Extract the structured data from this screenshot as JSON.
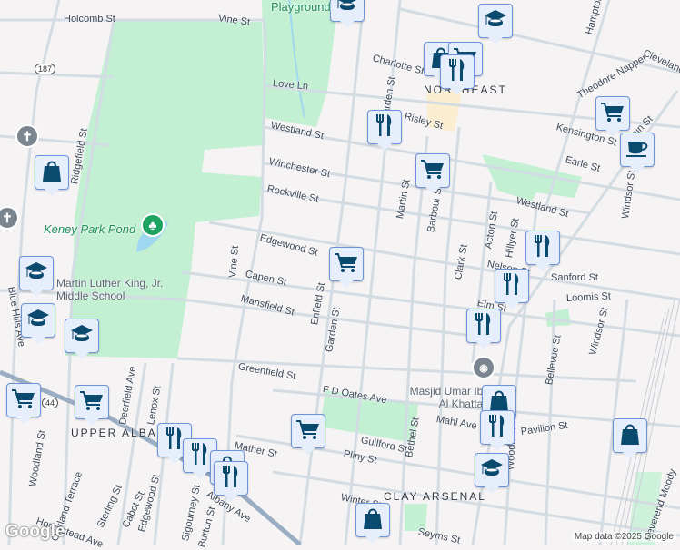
{
  "map": {
    "streets": [
      {
        "id": "holcomb-st",
        "label": "Holcomb St"
      },
      {
        "id": "vine-st-top",
        "label": "Vine St"
      },
      {
        "id": "love-ln",
        "label": "Love Ln"
      },
      {
        "id": "westland-st",
        "label": "Westland St"
      },
      {
        "id": "winchester-st",
        "label": "Winchester St"
      },
      {
        "id": "rockville-st",
        "label": "Rockville St"
      },
      {
        "id": "edgewood-st",
        "label": "Edgewood St"
      },
      {
        "id": "capen-st",
        "label": "Capen St"
      },
      {
        "id": "mansfield-st",
        "label": "Mansfield St"
      },
      {
        "id": "greenfield-st",
        "label": "Greenfield St"
      },
      {
        "id": "fd-oates-ave",
        "label": "F D Oates Ave"
      },
      {
        "id": "mahl-ave",
        "label": "Mahl Ave"
      },
      {
        "id": "pavilion-st",
        "label": "Pavilion St"
      },
      {
        "id": "guilford-st",
        "label": "Guilford St"
      },
      {
        "id": "pliny-st",
        "label": "Pliny St"
      },
      {
        "id": "mather-st",
        "label": "Mather St"
      },
      {
        "id": "winter-st",
        "label": "Winter St"
      },
      {
        "id": "seyms-st",
        "label": "Seyms St"
      },
      {
        "id": "charlotte-st",
        "label": "Charlotte St"
      },
      {
        "id": "risley-st",
        "label": "Risley St"
      },
      {
        "id": "kensington-st",
        "label": "Kensington St"
      },
      {
        "id": "earle-st",
        "label": "Earle St"
      },
      {
        "id": "westland-st-east",
        "label": "Westland St"
      },
      {
        "id": "nelson-st",
        "label": "Nelson St"
      },
      {
        "id": "sanford-st",
        "label": "Sanford St"
      },
      {
        "id": "loomis-st",
        "label": "Loomis St"
      },
      {
        "id": "elm-st",
        "label": "Elm St"
      },
      {
        "id": "cleveland-ave",
        "label": "Cleveland"
      },
      {
        "id": "theodore-napper",
        "label": "Theodore Napper"
      },
      {
        "id": "main-st",
        "label": "Main St"
      },
      {
        "id": "windsor-st",
        "label": "Windsor St"
      },
      {
        "id": "windsor-st-south",
        "label": "Windsor St"
      },
      {
        "id": "hampton",
        "label": "Hampton"
      },
      {
        "id": "martin-st",
        "label": "Martin St"
      },
      {
        "id": "barbour-st",
        "label": "Barbour St"
      },
      {
        "id": "clark-st",
        "label": "Clark St"
      },
      {
        "id": "acton-st",
        "label": "Acton St"
      },
      {
        "id": "hillyer-st",
        "label": "Hillyer St"
      },
      {
        "id": "garden-st-north",
        "label": "Garden St"
      },
      {
        "id": "garden-st",
        "label": "Garden St"
      },
      {
        "id": "enfield-st",
        "label": "Enfield St"
      },
      {
        "id": "vine-st",
        "label": "Vine St"
      },
      {
        "id": "ridgefield-st",
        "label": "Ridgefield St"
      },
      {
        "id": "blue-hills-ave",
        "label": "Blue Hills Ave"
      },
      {
        "id": "woodland-st",
        "label": "Woodland St"
      },
      {
        "id": "oakland-terrace",
        "label": "Oakland Terrace"
      },
      {
        "id": "sterling-st",
        "label": "Sterling St"
      },
      {
        "id": "cabot-st",
        "label": "Cabot St"
      },
      {
        "id": "edgewood-st-south",
        "label": "Edgewood St"
      },
      {
        "id": "deerfield-ave",
        "label": "Deerfield Ave"
      },
      {
        "id": "lenox-st",
        "label": "Lenox St"
      },
      {
        "id": "sigourney-st",
        "label": "Sigourney St"
      },
      {
        "id": "burton-st",
        "label": "Burton St"
      },
      {
        "id": "albany-ave",
        "label": "Albany Ave"
      },
      {
        "id": "homestead-ave",
        "label": "Homestead Ave"
      },
      {
        "id": "bethel-st",
        "label": "Bethel St"
      },
      {
        "id": "woodland-st-east",
        "label": "Woodland St"
      },
      {
        "id": "bellevue-st",
        "label": "Bellevue St"
      },
      {
        "id": "reverend-moody",
        "label": "Reverend Moody"
      }
    ],
    "neighborhoods": [
      "NORTHEAST",
      "UPPER ALBANY",
      "CLAY ARSENAL"
    ],
    "places": {
      "pond": "Keney Park Pond",
      "school": "Martin Luther King, Jr. Middle School",
      "mosque": "Masjid Umar Ibn Al Khattab",
      "playground": "Playground"
    },
    "route_shields": [
      "187",
      "44"
    ],
    "markers": [
      "school-icon",
      "school-icon",
      "shopping-bag-icon",
      "grocery-cart-icon",
      "restaurant-icon",
      "restaurant-icon",
      "grocery-cart-icon",
      "grocery-cart-icon",
      "coffee-icon",
      "restaurant-icon",
      "grocery-cart-icon",
      "restaurant-icon",
      "restaurant-icon",
      "shopping-bag-icon",
      "school-icon",
      "school-icon",
      "school-icon",
      "grocery-cart-icon",
      "grocery-cart-icon",
      "restaurant-icon",
      "restaurant-icon",
      "shopping-bag-icon",
      "restaurant-icon",
      "grocery-cart-icon",
      "shopping-bag-icon",
      "restaurant-icon",
      "school-icon",
      "shopping-bag-icon",
      "shopping-bag-icon"
    ],
    "attribution": "Map data ©2025 Google",
    "logo": "Google"
  },
  "colors": {
    "park": "#c3f0d3",
    "road": "#d3dbe3",
    "arterial": "#93a7bd",
    "marker_bg": "#e6edfb",
    "icon": "#0b4a6f"
  }
}
